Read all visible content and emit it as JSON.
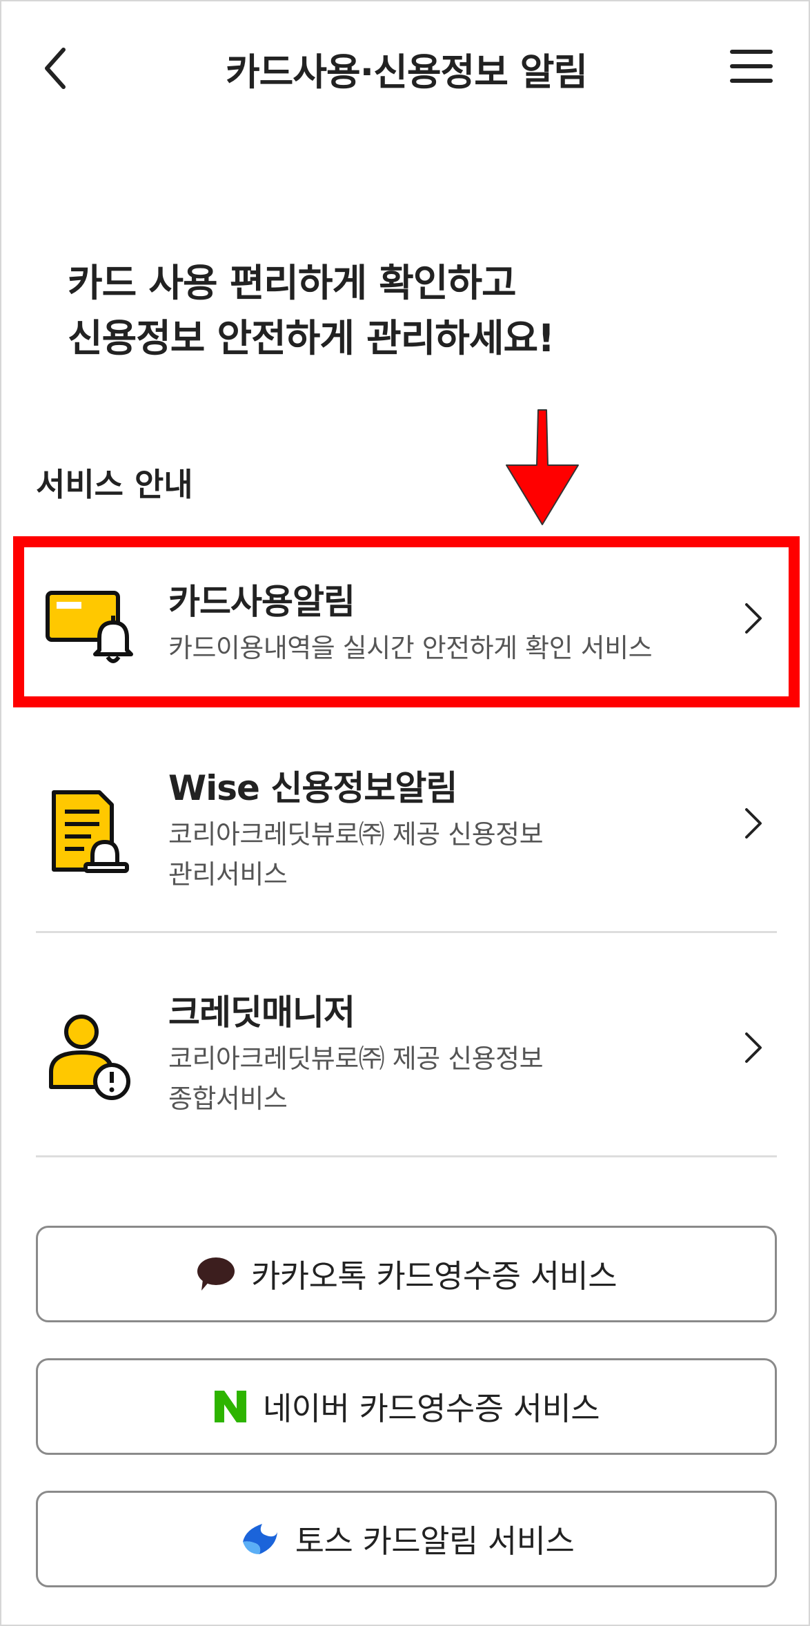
{
  "header": {
    "title": "카드사용·신용정보 알림"
  },
  "headline": {
    "line1": "카드 사용 편리하게 확인하고",
    "line2": "신용정보 안전하게 관리하세요!"
  },
  "section": {
    "label": "서비스 안내"
  },
  "services": [
    {
      "title": "카드사용알림",
      "desc1": "카드이용내역을 실시간 안전하게 확인 서비스",
      "icon": "card-bell-icon"
    },
    {
      "title": "Wise 신용정보알림",
      "desc1": "코리아크레딧뷰로㈜ 제공 신용정보",
      "desc2": "관리서비스",
      "icon": "document-bell-icon"
    },
    {
      "title": "크레딧매니저",
      "desc1": "코리아크레딧뷰로㈜ 제공 신용정보",
      "desc2": "종합서비스",
      "icon": "person-alert-icon"
    }
  ],
  "buttons": {
    "kakao": "카카오톡 카드영수증 서비스",
    "naver": "네이버 카드영수증 서비스",
    "toss": "토스 카드알림 서비스"
  },
  "colors": {
    "accent_yellow": "#FFC800",
    "annotation_red": "#FF0000",
    "naver_green": "#2DB400",
    "toss_blue": "#1B64DA",
    "kakao_brown": "#3C1E1E"
  }
}
